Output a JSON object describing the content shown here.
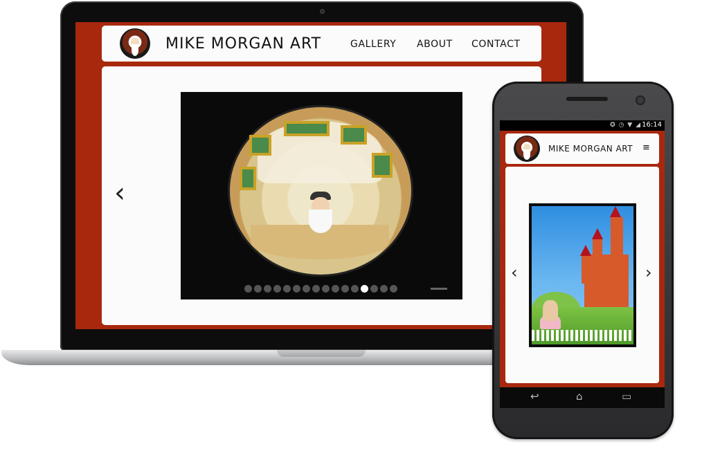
{
  "desktop": {
    "site_title": "MIKE MORGAN ART",
    "nav": [
      "GALLERY",
      "ABOUT",
      "CONTACT"
    ],
    "prev_arrow": "‹",
    "slide_count": 16,
    "active_slide": 12
  },
  "mobile": {
    "status_icons": "✪ ◷ ▼ ◢",
    "status_time": "16:14",
    "site_title": "MIKE MORGAN ART",
    "menu_icon": "≡",
    "prev_arrow": "‹",
    "next_arrow": "›",
    "nav_back": "↩",
    "nav_home": "⌂",
    "nav_recent": "▭"
  },
  "colors": {
    "brand_red": "#a8280e",
    "panel": "#fbfbfb"
  }
}
